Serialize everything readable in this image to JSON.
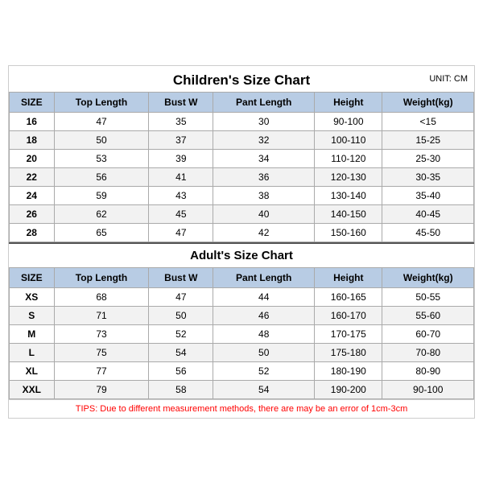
{
  "mainTitle": "Children's Size Chart",
  "unitLabel": "UNIT: CM",
  "childrenHeaders": [
    "SIZE",
    "Top Length",
    "Bust W",
    "Pant Length",
    "Height",
    "Weight(kg)"
  ],
  "childrenRows": [
    [
      "16",
      "47",
      "35",
      "30",
      "90-100",
      "<15"
    ],
    [
      "18",
      "50",
      "37",
      "32",
      "100-110",
      "15-25"
    ],
    [
      "20",
      "53",
      "39",
      "34",
      "110-120",
      "25-30"
    ],
    [
      "22",
      "56",
      "41",
      "36",
      "120-130",
      "30-35"
    ],
    [
      "24",
      "59",
      "43",
      "38",
      "130-140",
      "35-40"
    ],
    [
      "26",
      "62",
      "45",
      "40",
      "140-150",
      "40-45"
    ],
    [
      "28",
      "65",
      "47",
      "42",
      "150-160",
      "45-50"
    ]
  ],
  "adultTitle": "Adult's Size Chart",
  "adultHeaders": [
    "SIZE",
    "Top Length",
    "Bust W",
    "Pant Length",
    "Height",
    "Weight(kg)"
  ],
  "adultRows": [
    [
      "XS",
      "68",
      "47",
      "44",
      "160-165",
      "50-55"
    ],
    [
      "S",
      "71",
      "50",
      "46",
      "160-170",
      "55-60"
    ],
    [
      "M",
      "73",
      "52",
      "48",
      "170-175",
      "60-70"
    ],
    [
      "L",
      "75",
      "54",
      "50",
      "175-180",
      "70-80"
    ],
    [
      "XL",
      "77",
      "56",
      "52",
      "180-190",
      "80-90"
    ],
    [
      "XXL",
      "79",
      "58",
      "54",
      "190-200",
      "90-100"
    ]
  ],
  "tipsText": "TIPS: Due to different measurement methods, there are may be an error of 1cm-3cm"
}
